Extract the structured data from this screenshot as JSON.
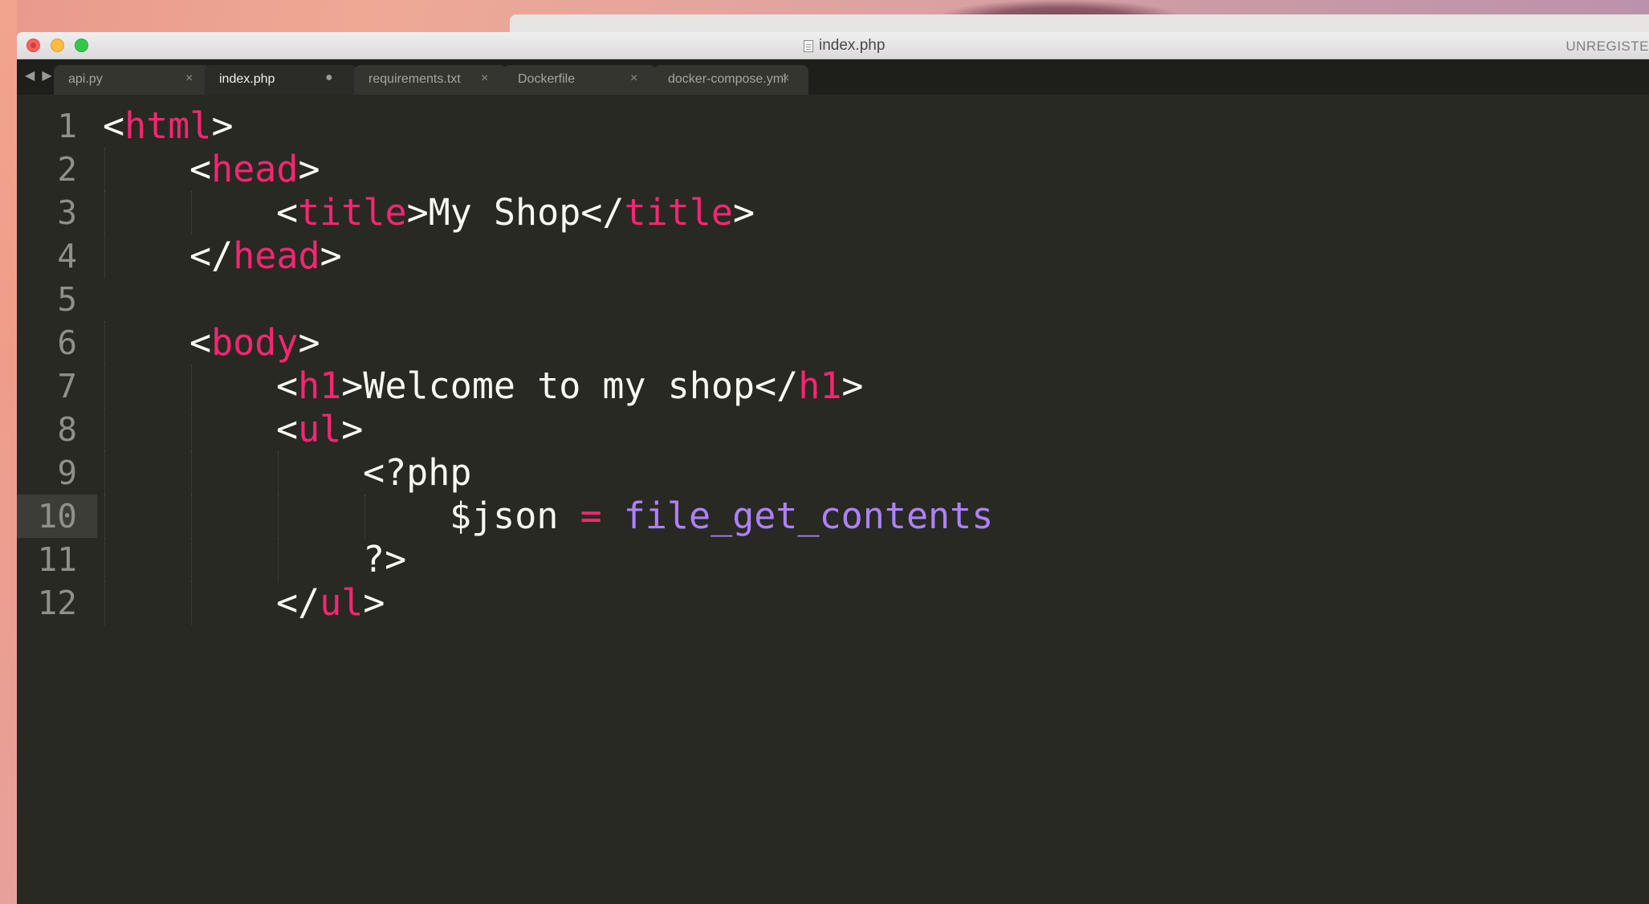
{
  "window": {
    "title": "index.php",
    "unregistered_label": "UNREGISTE"
  },
  "tabs": [
    {
      "label": "api.py",
      "active": false,
      "modified": false
    },
    {
      "label": "index.php",
      "active": true,
      "modified": true
    },
    {
      "label": "requirements.txt",
      "active": false,
      "modified": false
    },
    {
      "label": "Dockerfile",
      "active": false,
      "modified": false
    },
    {
      "label": "docker-compose.yml",
      "active": false,
      "modified": false
    }
  ],
  "tab_close_glyph": "×",
  "tab_modified_glyph": "●",
  "nav": {
    "back": "◀",
    "forward": "▶"
  },
  "editor": {
    "current_line": 10,
    "theme_colors": {
      "background": "#282923",
      "tag": "#f92672",
      "function": "#ae81ff",
      "text": "#f8f8f2",
      "gutter": "#8f908a"
    },
    "lines": [
      {
        "num": "1",
        "indent": 0,
        "tokens": [
          {
            "t": "<",
            "c": ""
          },
          {
            "t": "html",
            "c": "tag"
          },
          {
            "t": ">",
            "c": ""
          }
        ]
      },
      {
        "num": "2",
        "indent": 1,
        "tokens": [
          {
            "t": "<",
            "c": ""
          },
          {
            "t": "head",
            "c": "tag"
          },
          {
            "t": ">",
            "c": ""
          }
        ]
      },
      {
        "num": "3",
        "indent": 2,
        "tokens": [
          {
            "t": "<",
            "c": ""
          },
          {
            "t": "title",
            "c": "tag"
          },
          {
            "t": ">My Shop</",
            "c": ""
          },
          {
            "t": "title",
            "c": "tag"
          },
          {
            "t": ">",
            "c": ""
          }
        ]
      },
      {
        "num": "4",
        "indent": 1,
        "tokens": [
          {
            "t": "</",
            "c": ""
          },
          {
            "t": "head",
            "c": "tag"
          },
          {
            "t": ">",
            "c": ""
          }
        ]
      },
      {
        "num": "5",
        "indent": 0,
        "tokens": []
      },
      {
        "num": "6",
        "indent": 1,
        "tokens": [
          {
            "t": "<",
            "c": ""
          },
          {
            "t": "body",
            "c": "tag"
          },
          {
            "t": ">",
            "c": ""
          }
        ]
      },
      {
        "num": "7",
        "indent": 2,
        "tokens": [
          {
            "t": "<",
            "c": ""
          },
          {
            "t": "h1",
            "c": "tag"
          },
          {
            "t": ">Welcome to my shop</",
            "c": ""
          },
          {
            "t": "h1",
            "c": "tag"
          },
          {
            "t": ">",
            "c": ""
          }
        ]
      },
      {
        "num": "8",
        "indent": 2,
        "tokens": [
          {
            "t": "<",
            "c": ""
          },
          {
            "t": "ul",
            "c": "tag"
          },
          {
            "t": ">",
            "c": ""
          }
        ]
      },
      {
        "num": "9",
        "indent": 3,
        "tokens": [
          {
            "t": "<?php",
            "c": ""
          }
        ]
      },
      {
        "num": "10",
        "indent": 4,
        "tokens": [
          {
            "t": "$json ",
            "c": ""
          },
          {
            "t": "=",
            "c": "tag"
          },
          {
            "t": " ",
            "c": ""
          },
          {
            "t": "file_get_contents",
            "c": "fn"
          }
        ]
      },
      {
        "num": "11",
        "indent": 3,
        "tokens": [
          {
            "t": "?>",
            "c": ""
          }
        ]
      },
      {
        "num": "12",
        "indent": 2,
        "tokens": [
          {
            "t": "</",
            "c": ""
          },
          {
            "t": "ul",
            "c": "tag"
          },
          {
            "t": ">",
            "c": ""
          }
        ]
      }
    ]
  }
}
